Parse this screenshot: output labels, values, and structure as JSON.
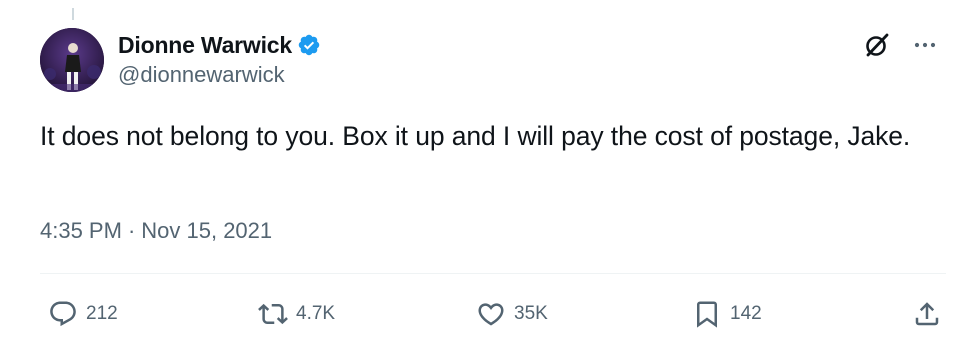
{
  "user": {
    "display_name": "Dionne Warwick",
    "handle": "@dionnewarwick",
    "verified": true
  },
  "tweet": {
    "text": "It does not belong to you. Box it up and I will pay the cost of postage, Jake.",
    "time": "4:35 PM",
    "separator": "·",
    "date": "Nov 15, 2021"
  },
  "actions": {
    "replies": "212",
    "reposts": "4.7K",
    "likes": "35K",
    "bookmarks": "142"
  },
  "colors": {
    "accent": "#1d9bf0",
    "text": "#0f1419",
    "secondary": "#536471"
  },
  "icons": [
    "verified-badge-icon",
    "grok-icon",
    "more-icon",
    "reply-icon",
    "repost-icon",
    "like-icon",
    "bookmark-icon",
    "share-icon"
  ]
}
